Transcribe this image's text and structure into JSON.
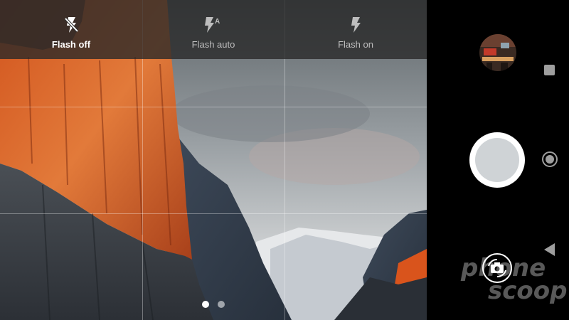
{
  "flash_bar": {
    "options": [
      {
        "label": "Flash off",
        "icon": "flash-off-icon",
        "active": true
      },
      {
        "label": "Flash auto",
        "icon": "flash-auto-icon",
        "active": false
      },
      {
        "label": "Flash on",
        "icon": "flash-on-icon",
        "active": false
      }
    ]
  },
  "viewfinder": {
    "page_indicator": {
      "count": 2,
      "current": 1
    }
  },
  "sidebar": {
    "gallery_thumbnail": "gallery-thumbnail",
    "shutter_icon": "shutter-button-icon",
    "switch_camera_icon": "switch-camera-icon"
  },
  "nav_bar": {
    "items": [
      "recents-square-icon",
      "home-circle-icon",
      "back-triangle-icon"
    ]
  },
  "watermark": {
    "line1": "phone",
    "line2": "scoop"
  },
  "colors": {
    "flash_bar_bg": "#2c2c2c",
    "active_label": "#ffffff",
    "inactive_label": "#bdbdbd",
    "shutter_inner": "#cfd3d6"
  }
}
